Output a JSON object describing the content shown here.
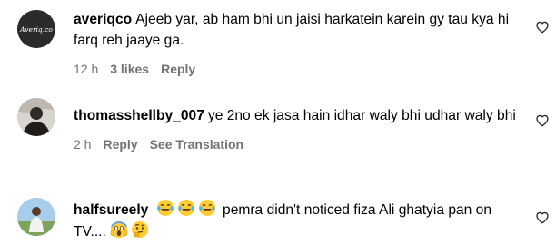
{
  "comments": [
    {
      "username": "averiqco",
      "text": "Ajeeb yar, ab ham bhi un jaisi harkatein karein gy tau kya hi farq reh jaaye ga.",
      "time": "12 h",
      "likes": "3 likes",
      "reply": "Reply",
      "avatar_text": "Averiq.co",
      "avatar_icon": "averiqco-logo-icon",
      "like_icon": "heart-outline-icon"
    },
    {
      "username": "thomasshellby_007",
      "text": "ye 2no ek jasa hain idhar waly bhi udhar waly bhi",
      "time": "2 h",
      "reply": "Reply",
      "translation": "See Translation",
      "avatar_icon": "user-photo-avatar",
      "like_icon": "heart-outline-icon"
    },
    {
      "username": "halfsureely",
      "emojis_lead": [
        "laughing-crying-face-emoji",
        "laughing-crying-face-emoji",
        "laughing-crying-face-emoji"
      ],
      "text": "pemra didn't noticed fiza Ali ghatyia pan on TV....",
      "emojis_trail": [
        "screaming-face-emoji",
        "thinking-face-emoji"
      ],
      "avatar_icon": "user-photo-avatar",
      "like_icon": "heart-outline-icon"
    }
  ],
  "colors": {
    "text": "#000000",
    "meta": "#737373",
    "avatar_dark": "#2b2b2b"
  }
}
